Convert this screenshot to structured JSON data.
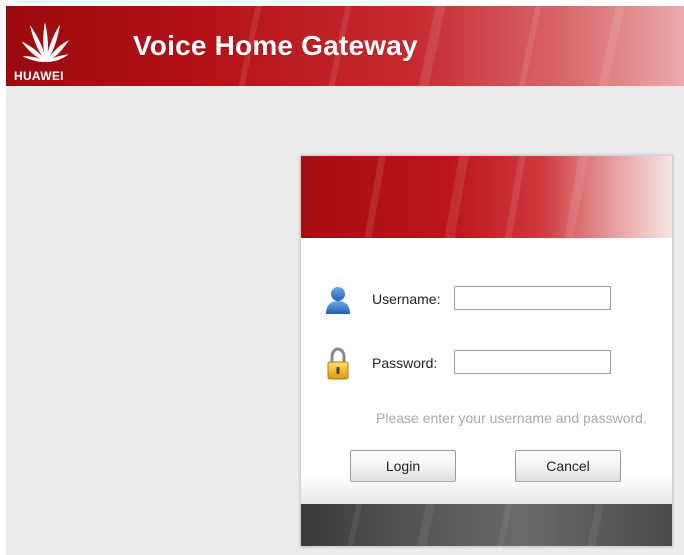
{
  "header": {
    "brand": "HUAWEI",
    "title": "Voice Home Gateway"
  },
  "login": {
    "username_label": "Username:",
    "username_value": "",
    "password_label": "Password:",
    "password_value": "",
    "hint": "Please enter your username and password.",
    "login_button": "Login",
    "cancel_button": "Cancel"
  },
  "icons": {
    "logo": "huawei-logo",
    "user": "user-icon",
    "lock": "lock-icon"
  },
  "colors": {
    "brand_red": "#b5121a",
    "input_border": "#8fa2b8",
    "hint_text": "#a9a9a9",
    "footer_dark": "#545454"
  }
}
